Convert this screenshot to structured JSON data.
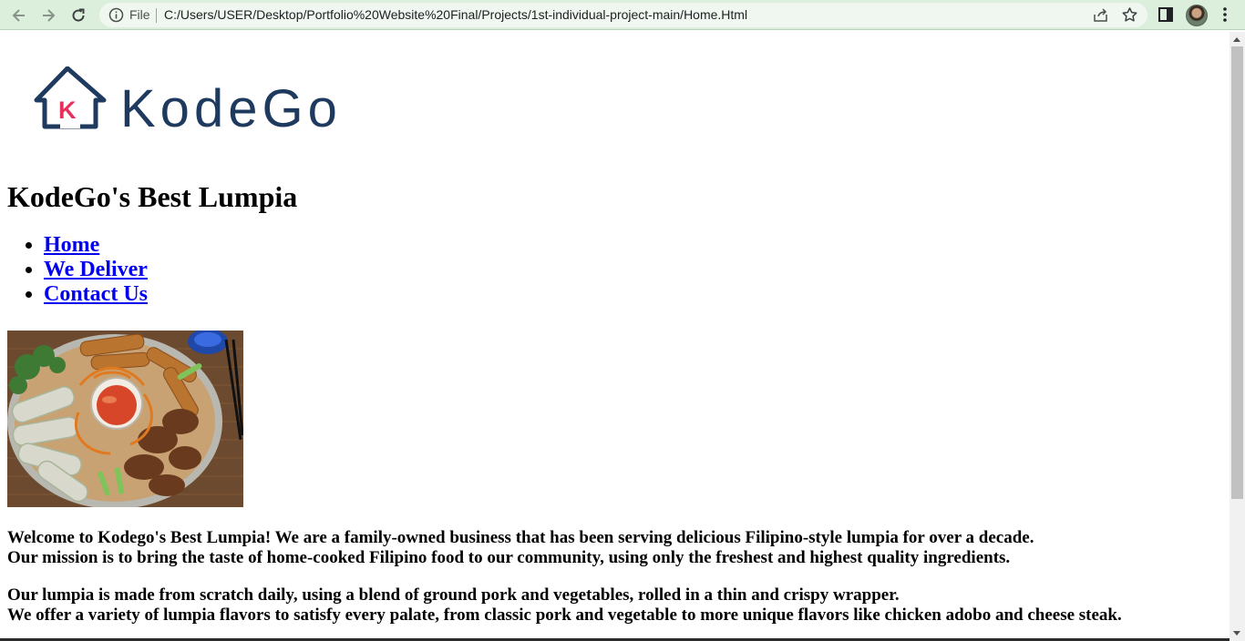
{
  "browser": {
    "file_label": "File",
    "url": "C:/Users/USER/Desktop/Portfolio%20Website%20Final/Projects/1st-individual-project-main/Home.Html"
  },
  "logo": {
    "text": "KodeGo",
    "emblem_letter": "K",
    "colors": {
      "navy": "#1f3a5f",
      "accent": "#e8305c"
    }
  },
  "page": {
    "title": "KodeGo's Best Lumpia",
    "nav": [
      {
        "label": "Home"
      },
      {
        "label": "We Deliver"
      },
      {
        "label": "Contact Us"
      }
    ],
    "paragraphs": [
      {
        "line1": "Welcome to Kodego's Best Lumpia! We are a family-owned business that has been serving delicious Filipino-style lumpia for over a decade.",
        "line2": "Our mission is to bring the taste of home-cooked Filipino food to our community, using only the freshest and highest quality ingredients."
      },
      {
        "line1": "Our lumpia is made from scratch daily, using a blend of ground pork and vegetables, rolled in a thin and crispy wrapper.",
        "line2": "We offer a variety of lumpia flavors to satisfy every palate, from classic pork and vegetable to more unique flavors like chicken adobo and cheese steak."
      }
    ]
  },
  "colors": {
    "link": "#0000ee",
    "toolbar": "#dcefdc"
  }
}
